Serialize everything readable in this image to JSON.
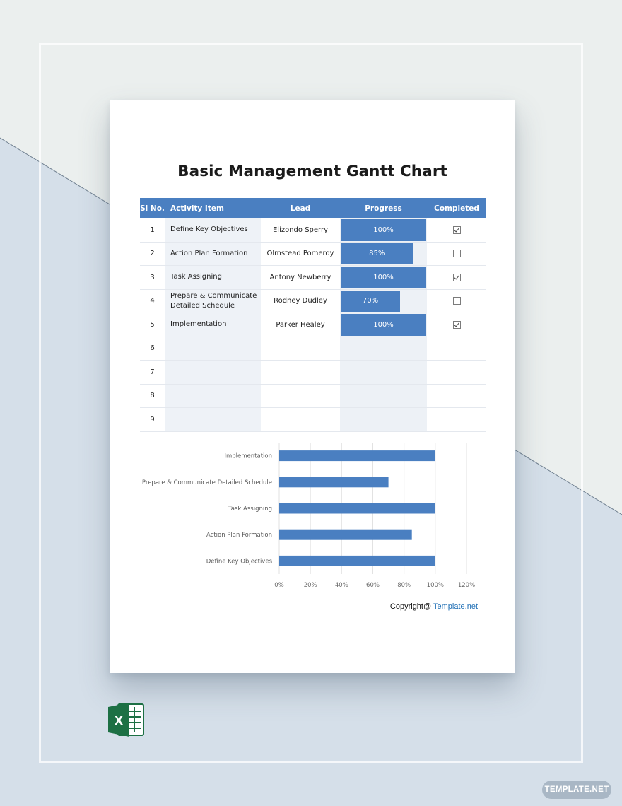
{
  "document": {
    "title": "Basic Management Gantt Chart",
    "copyright_prefix": "Copyright@ ",
    "copyright_brand": "Template.net"
  },
  "table": {
    "headers": [
      "Sl No.",
      "Activity Item",
      "Lead",
      "Progress",
      "Completed"
    ],
    "rows": [
      {
        "num": "1",
        "activity": "Define Key Objectives",
        "lead": "Elizondo Sperry",
        "progress_label": "100%",
        "progress": 1.0,
        "completed": true
      },
      {
        "num": "2",
        "activity": "Action Plan Formation",
        "lead": "Olmstead  Pomeroy",
        "progress_label": "85%",
        "progress": 0.85,
        "completed": false
      },
      {
        "num": "3",
        "activity": "Task Assigning",
        "lead": "Antony Newberry",
        "progress_label": "100%",
        "progress": 1.0,
        "completed": true
      },
      {
        "num": "4",
        "activity": "Prepare & Communicate Detailed Schedule",
        "lead": "Rodney Dudley",
        "progress_label": "70%",
        "progress": 0.7,
        "completed": false
      },
      {
        "num": "5",
        "activity": "Implementation",
        "lead": "Parker Healey",
        "progress_label": "100%",
        "progress": 1.0,
        "completed": true
      },
      {
        "num": "6",
        "activity": "",
        "lead": "",
        "progress_label": "",
        "progress": 0,
        "completed": null
      },
      {
        "num": "7",
        "activity": "",
        "lead": "",
        "progress_label": "",
        "progress": 0,
        "completed": null
      },
      {
        "num": "8",
        "activity": "",
        "lead": "",
        "progress_label": "",
        "progress": 0,
        "completed": null
      },
      {
        "num": "9",
        "activity": "",
        "lead": "",
        "progress_label": "",
        "progress": 0,
        "completed": null
      }
    ]
  },
  "chart_data": {
    "type": "bar",
    "orientation": "horizontal",
    "categories": [
      "Implementation",
      "Prepare & Communicate Detailed Schedule",
      "Task Assigning",
      "Action Plan Formation",
      "Define Key Objectives"
    ],
    "values": [
      100,
      70,
      100,
      85,
      100
    ],
    "xlim": [
      0,
      120
    ],
    "xticks": [
      "0%",
      "20%",
      "40%",
      "60%",
      "80%",
      "100%",
      "120%"
    ],
    "grid": true,
    "color": "#4a7fc1"
  },
  "colors": {
    "accent": "#4a7fc1",
    "excel_green": "#1d7044"
  },
  "watermark": "TEMPLATE.NET",
  "excel_icon": "excel-icon"
}
